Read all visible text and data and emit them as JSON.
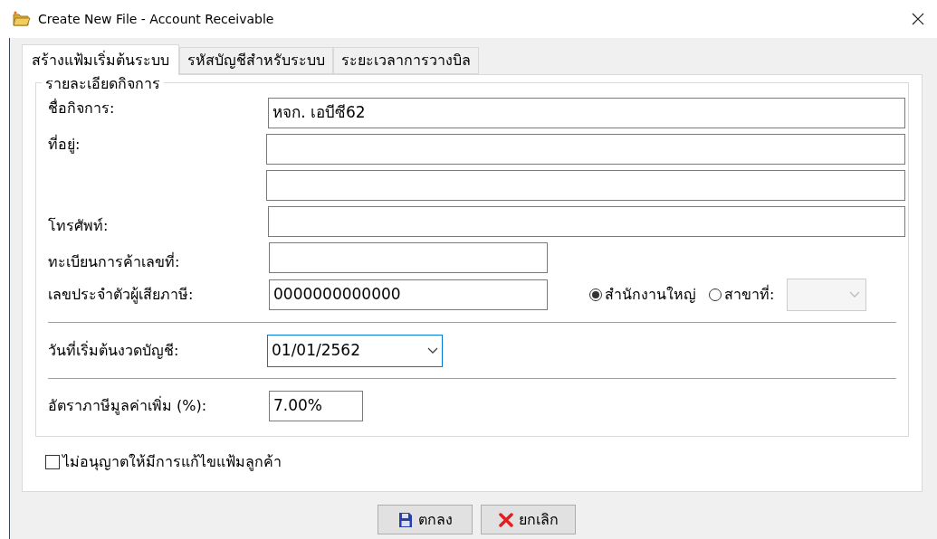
{
  "window": {
    "title": "Create New File - Account Receivable"
  },
  "tabs": [
    {
      "label": "สร้างแฟ้มเริ่มต้นระบบ",
      "selected": true
    },
    {
      "label": "รหัสบัญชีสำหรับระบบ",
      "selected": false
    },
    {
      "label": "ระยะเวลาการวางบิล",
      "selected": false
    }
  ],
  "group": {
    "title": "รายละเอียดกิจการ",
    "business_name": {
      "label": "ชื่อกิจการ:",
      "value": "หจก. เอบีซี62"
    },
    "address": {
      "label": "ที่อยู่:"
    },
    "phone": {
      "label": "โทรศัพท์:"
    },
    "registration_no": {
      "label": "ทะเบียนการค้าเลขที่:"
    },
    "tax_id": {
      "label": "เลขประจำตัวผู้เสียภาษี:",
      "value": "0000000000000"
    },
    "office_type": [
      {
        "label": "สำนักงานใหญ่",
        "selected": true
      },
      {
        "label": "สาขาที่:",
        "selected": false
      }
    ],
    "branch_select": {
      "disabled": true
    },
    "start_date": {
      "label": "วันที่เริ่มต้นงวดบัญชี:",
      "value": "01/01/2562",
      "focused": true
    },
    "vat_rate": {
      "label": "อัตราภาษีมูลค่าเพิ่ม (%):",
      "value": "7.00%"
    }
  },
  "lock_customer": {
    "label": "ไม่อนุญาตให้มีการแก้ไขแฟ้มลูกค้า",
    "checked": false
  },
  "buttons": [
    {
      "label": "ตกลง",
      "kind": "save"
    },
    {
      "label": "ยกเลิก",
      "kind": "cancel"
    }
  ]
}
